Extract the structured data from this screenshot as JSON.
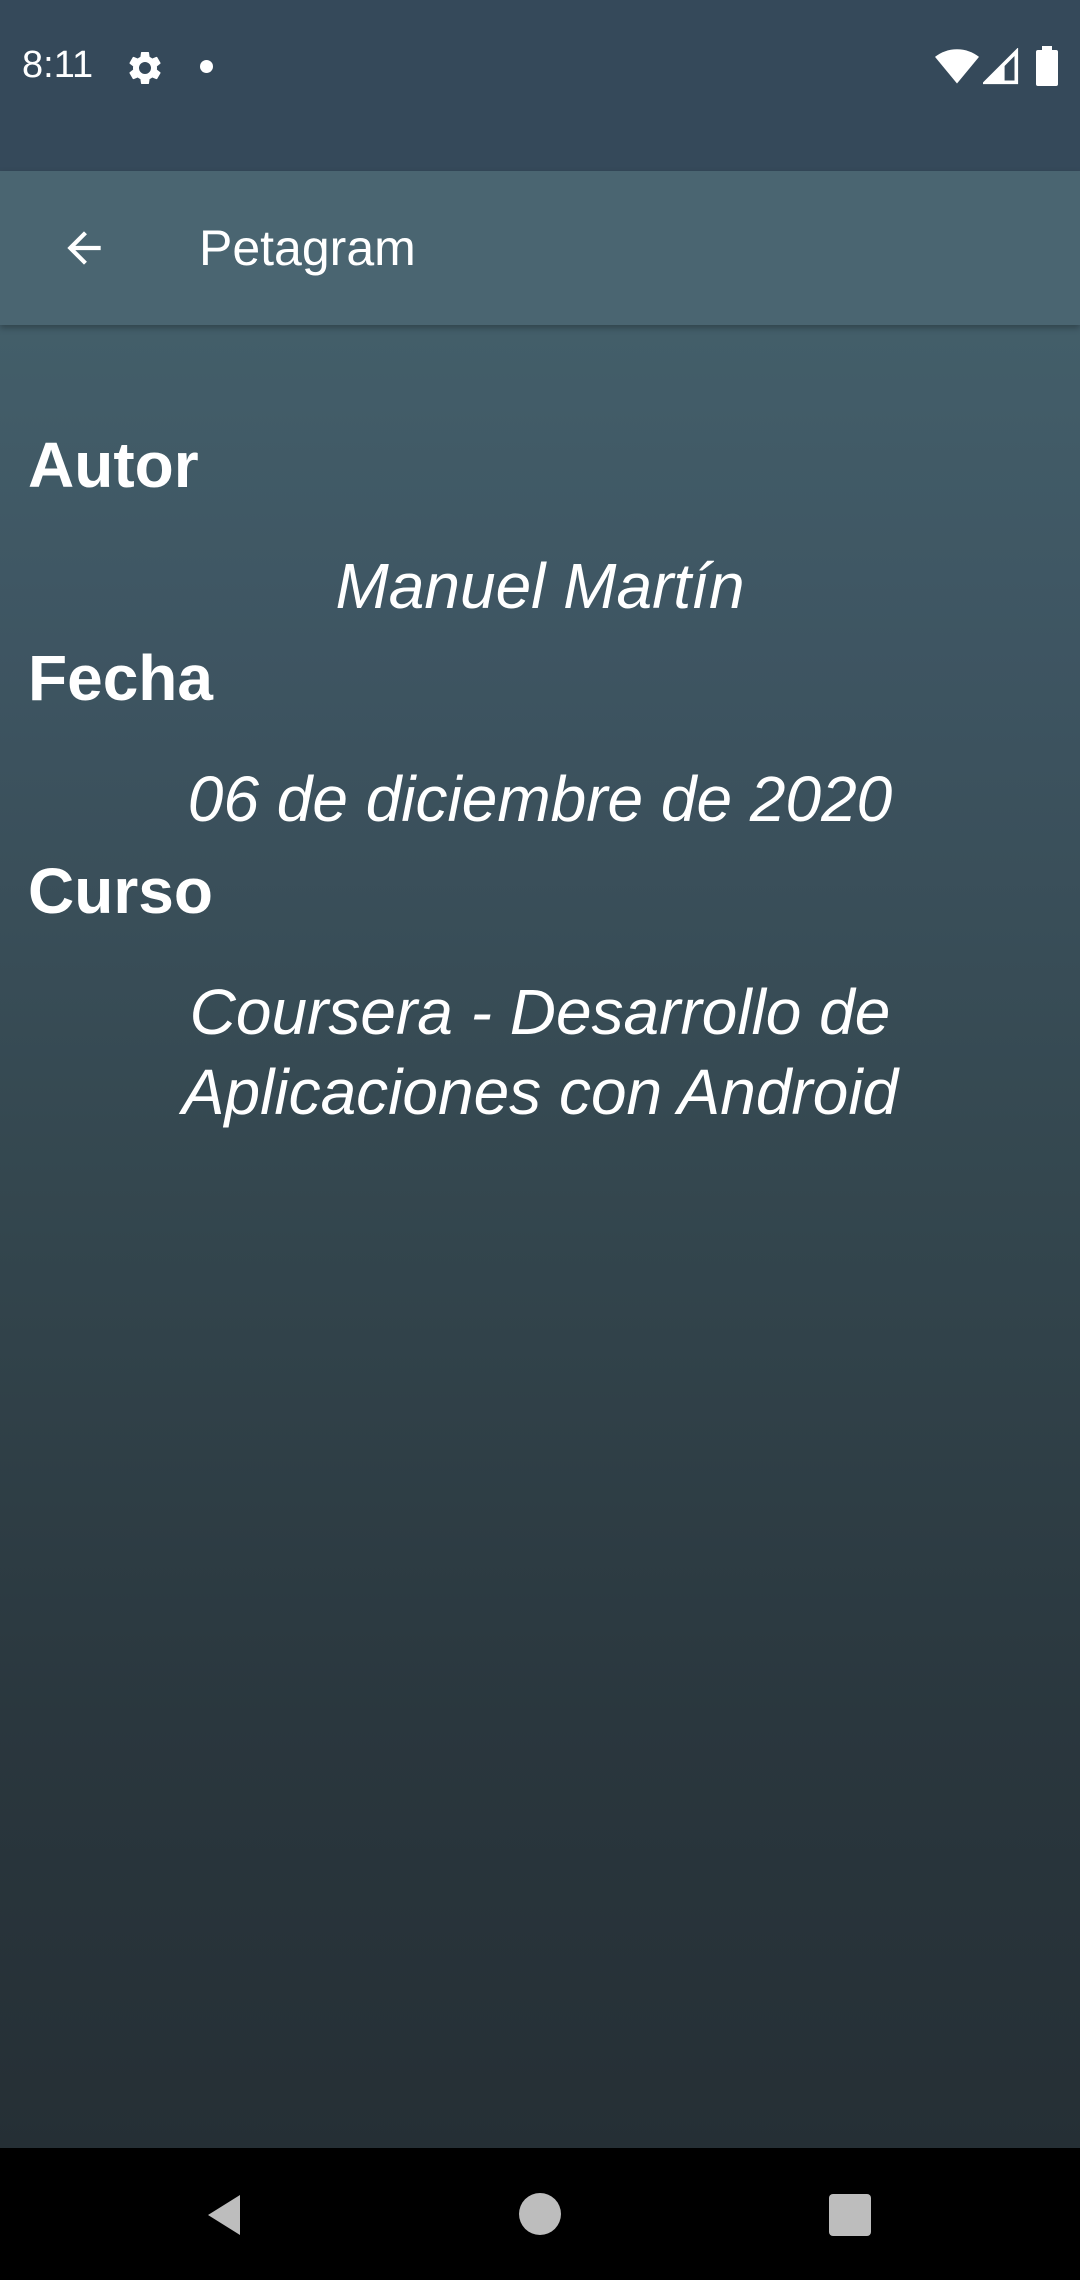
{
  "status_bar": {
    "time": "8:11",
    "icons": [
      "gear-icon",
      "notification-dot-icon",
      "wifi-icon",
      "cell-signal-icon",
      "battery-icon"
    ]
  },
  "app_bar": {
    "title": "Petagram",
    "back_icon": "arrow-left-icon"
  },
  "content": {
    "author_label": "Autor",
    "author_value": "Manuel Martín",
    "date_label": "Fecha",
    "date_value": "06 de diciembre de 2020",
    "course_label": "Curso",
    "course_value_line1": "Coursera - Desarrollo de",
    "course_value_line2": "Aplicaciones con Android"
  },
  "nav_bar": {
    "buttons": [
      "back-triangle-icon",
      "home-circle-icon",
      "recents-square-icon"
    ]
  },
  "colors": {
    "status_bar": "#35495a",
    "app_bar": "#4a6571",
    "gradient_top": "#4a6470",
    "gradient_bottom": "#252f35",
    "text": "#ffffff"
  }
}
